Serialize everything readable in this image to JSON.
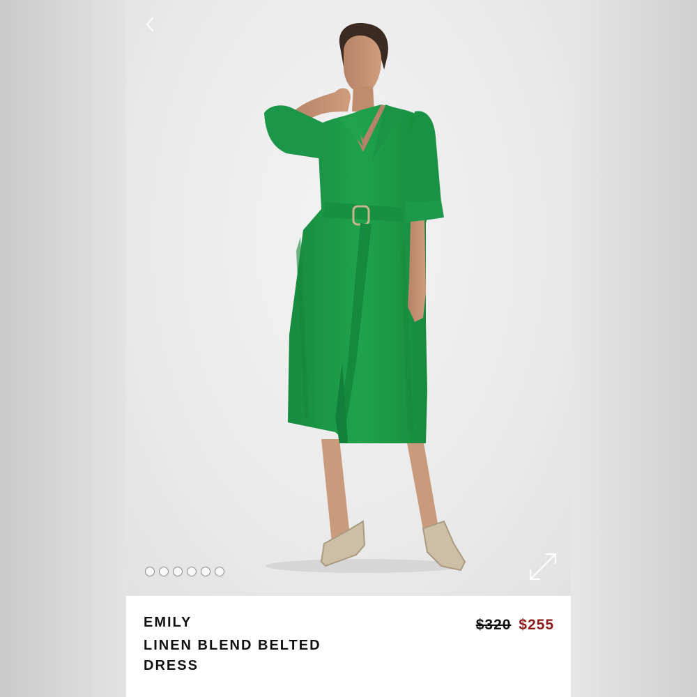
{
  "product": {
    "brand": "EMILY",
    "name": "LINEN BLEND BELTED DRESS",
    "price_original": "$320",
    "price_sale": "$255"
  },
  "gallery": {
    "image_count": 6,
    "active_index": 0
  },
  "colors": {
    "dress": "#1f9a4a",
    "sale_price": "#8b1a1a",
    "backdrop": "#ebebeb"
  },
  "icons": {
    "back": "chevron-left-icon",
    "expand": "expand-arrows-icon"
  }
}
